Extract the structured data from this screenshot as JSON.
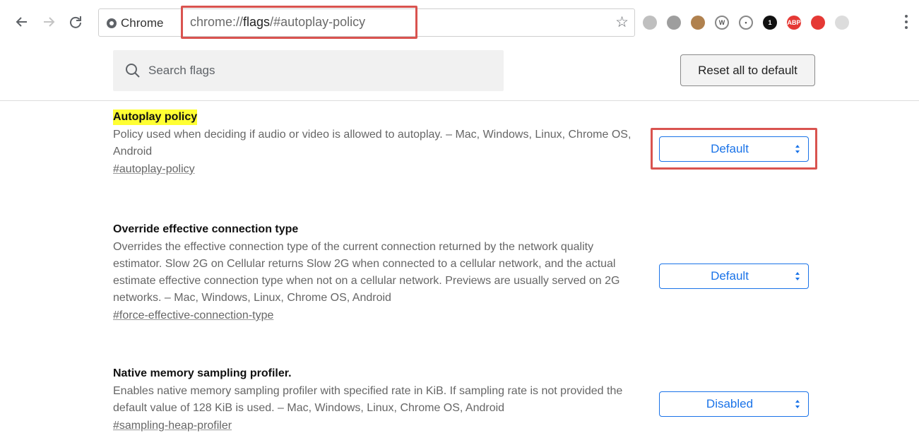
{
  "toolbar": {
    "site_label": "Chrome",
    "url_scheme": "chrome://",
    "url_host": "flags",
    "url_path": "/#autoplay-policy",
    "extensions": [
      {
        "name": "ext-1",
        "color": "#bfbfbf",
        "text": ""
      },
      {
        "name": "ext-2",
        "color": "#9e9e9e",
        "text": ""
      },
      {
        "name": "ext-3",
        "color": "#b0814e",
        "text": ""
      },
      {
        "name": "ext-4",
        "color": "#ffffff",
        "text": "W"
      },
      {
        "name": "ext-5",
        "color": "#ffffff",
        "text": "•"
      },
      {
        "name": "ext-6",
        "color": "#111111",
        "text": "1"
      },
      {
        "name": "ext-7",
        "color": "#e53935",
        "text": "ABP"
      },
      {
        "name": "ext-8",
        "color": "#e53935",
        "text": ""
      },
      {
        "name": "ext-9",
        "color": "#dcdcdc",
        "text": ""
      }
    ]
  },
  "header": {
    "search_placeholder": "Search flags",
    "reset_label": "Reset all to default"
  },
  "flags": [
    {
      "title": "Autoplay policy",
      "description": "Policy used when deciding if audio or video is allowed to autoplay. – Mac, Windows, Linux, Chrome OS, Android",
      "link": "#autoplay-policy",
      "value": "Default"
    },
    {
      "title": "Override effective connection type",
      "description": "Overrides the effective connection type of the current connection returned by the network quality estimator. Slow 2G on Cellular returns Slow 2G when connected to a cellular network, and the actual estimate effective connection type when not on a cellular network. Previews are usually served on 2G networks. – Mac, Windows, Linux, Chrome OS, Android",
      "link": "#force-effective-connection-type",
      "value": "Default"
    },
    {
      "title": "Native memory sampling profiler.",
      "description": "Enables native memory sampling profiler with specified rate in KiB. If sampling rate is not provided the default value of 128 KiB is used. – Mac, Windows, Linux, Chrome OS, Android",
      "link": "#sampling-heap-profiler",
      "value": "Disabled"
    }
  ],
  "colors": {
    "highlight": "#ffff33",
    "annotation_red": "#d9534f",
    "select_blue": "#1a73e8"
  }
}
